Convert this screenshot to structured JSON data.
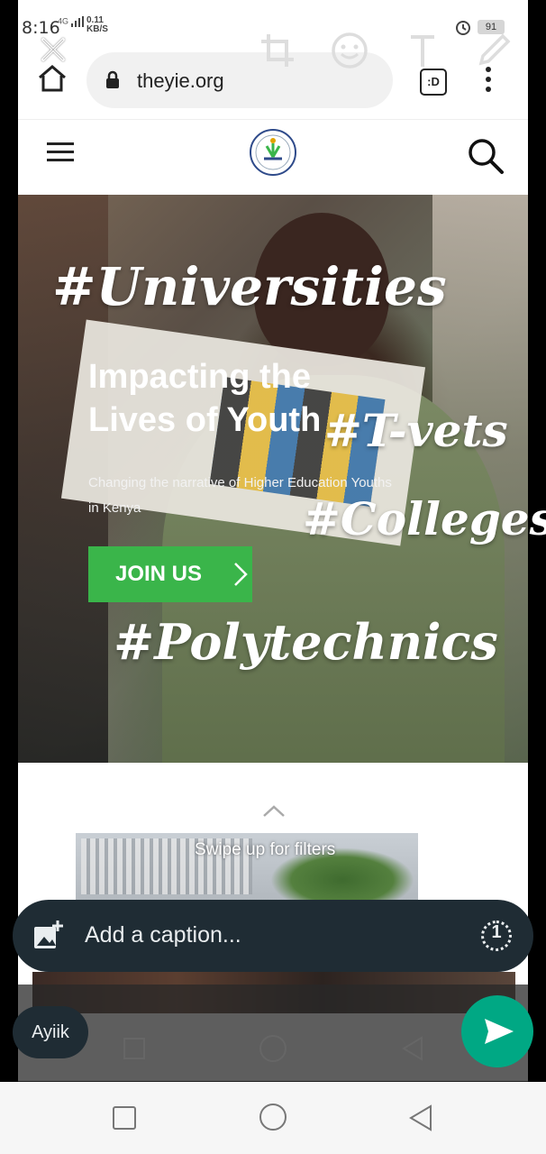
{
  "status_bar": {
    "time": "8:16",
    "network": "4G",
    "speed_value": "0.11",
    "speed_unit": "KB/S",
    "battery": "91"
  },
  "browser": {
    "url": "theyie.org",
    "tab_badge": ":D"
  },
  "editor_tools": [
    "close-icon",
    "crop-rotate-icon",
    "emoji-icon",
    "text-icon",
    "pencil-icon"
  ],
  "hero": {
    "tag_universities": "#Universities",
    "title_line1": "Impacting the",
    "title_line2": "Lives of Youth",
    "tag_tvets": "#T-vets",
    "subtitle_line1": "Changing the narrative of Higher Education Youths",
    "subtitle_line2": "in Kenya",
    "tag_colleges": "#Colleges",
    "join_label": "JOIN US",
    "tag_polytechnics": "#Polytechnics"
  },
  "swipe_hint": "Swipe up for filters",
  "caption": {
    "placeholder": "Add a caption...",
    "view_once": "1"
  },
  "recipient": "Ayiik",
  "colors": {
    "accent_green": "#3ab54a",
    "send_green": "#00a884",
    "caption_bg": "#1f2c34"
  }
}
